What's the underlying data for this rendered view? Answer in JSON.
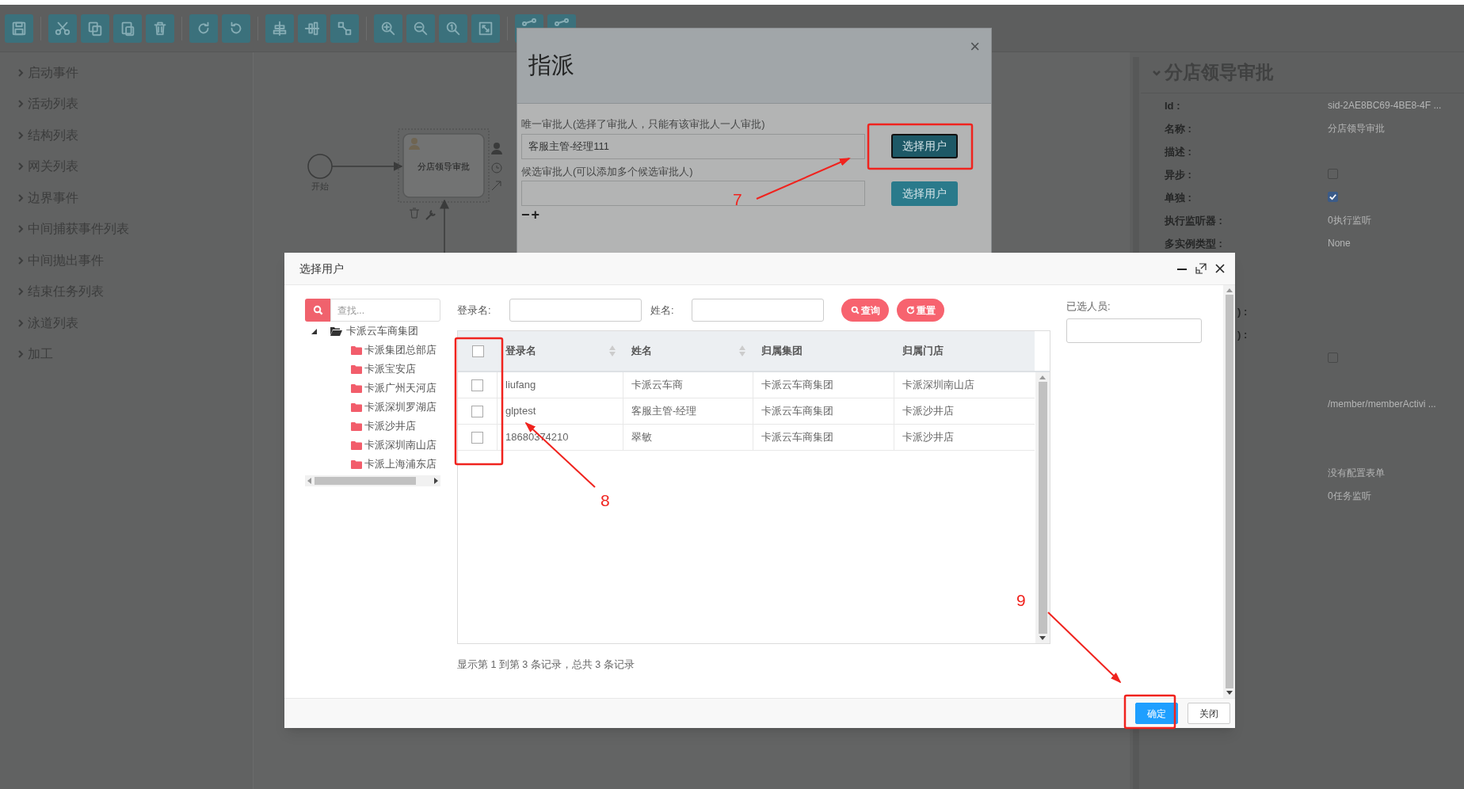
{
  "toolbar": {
    "groups": [
      {
        "buttons": [
          {
            "kind": "save"
          }
        ]
      },
      {
        "buttons": [
          {
            "kind": "cut"
          },
          {
            "kind": "copy"
          },
          {
            "kind": "paste"
          },
          {
            "kind": "delete"
          }
        ]
      },
      {
        "buttons": [
          {
            "kind": "redo"
          },
          {
            "kind": "undo"
          }
        ]
      },
      {
        "buttons": [
          {
            "kind": "align-horizontal"
          },
          {
            "kind": "align-vertical"
          },
          {
            "kind": "same-size"
          }
        ]
      },
      {
        "buttons": [
          {
            "kind": "zoom-in"
          },
          {
            "kind": "zoom-out"
          },
          {
            "kind": "zoom-actual"
          },
          {
            "kind": "zoom-fit"
          }
        ]
      },
      {
        "buttons": [
          {
            "kind": "connector"
          },
          {
            "kind": "connector"
          }
        ]
      }
    ]
  },
  "sidebar": {
    "items": [
      "启动事件",
      "活动列表",
      "结构列表",
      "网关列表",
      "边界事件",
      "中间捕获事件列表",
      "中间抛出事件",
      "结束任务列表",
      "泳道列表",
      "加工"
    ]
  },
  "canvas": {
    "start_event": {
      "label": "开始"
    },
    "task": {
      "label": "分店领导审批",
      "selected": true
    }
  },
  "properties": {
    "title": "分店领导审批",
    "expanded": true,
    "rows": [
      {
        "kind": "text",
        "label": "Id :",
        "value": "sid-2AE8BC69-4BE8-4F ..."
      },
      {
        "kind": "text",
        "label": "名称 :",
        "value": "分店领导审批"
      },
      {
        "kind": "text",
        "label": "描述 :"
      },
      {
        "kind": "checkbox",
        "label": "异步 :",
        "checked": false
      },
      {
        "kind": "checkbox",
        "label": "单独 :",
        "checked": true
      },
      {
        "kind": "text",
        "label": "执行监听器 :",
        "value": "0执行监听"
      },
      {
        "kind": "text",
        "label": "多实例类型 :",
        "value": "None"
      },
      {
        "kind": "covered"
      },
      {
        "kind": "covered"
      },
      {
        "kind": "cut",
        "label": ") :"
      },
      {
        "kind": "cut",
        "label": ") :"
      },
      {
        "kind": "checkbox",
        "checked": false
      },
      {
        "kind": "covered"
      },
      {
        "kind": "text",
        "value": "/member/memberActivi ..."
      },
      {
        "kind": "covered"
      },
      {
        "kind": "covered"
      },
      {
        "kind": "text",
        "value": "没有配置表单"
      },
      {
        "kind": "text",
        "value": "0任务监听"
      }
    ]
  },
  "assign_dialog": {
    "title": "指派",
    "close": "×",
    "fields": [
      {
        "label": "唯一审批人(选择了审批人，只能有该审批人一人审批)",
        "value": "客服主管-经理111",
        "button": "选择用户",
        "focused": true
      },
      {
        "label": "候选审批人(可以添加多个候选审批人)",
        "button": "选择用户",
        "focused": false
      }
    ],
    "row_controls": [
      "−",
      "+"
    ]
  },
  "select_dialog": {
    "title": "选择用户",
    "tree": {
      "search_placeholder": "查找...",
      "root": {
        "label": "卡派云车商集团",
        "expanded": true,
        "children": [
          {
            "label": "卡派集团总部店"
          },
          {
            "label": "卡派宝安店"
          },
          {
            "label": "卡派广州天河店"
          },
          {
            "label": "卡派深圳罗湖店"
          },
          {
            "label": "卡派沙井店"
          },
          {
            "label": "卡派深圳南山店"
          },
          {
            "label": "卡派上海浦东店"
          }
        ]
      }
    },
    "filters": [
      {
        "label": "登录名:"
      },
      {
        "label": "姓名:"
      }
    ],
    "buttons": [
      {
        "kind": "search",
        "label": "查询"
      },
      {
        "kind": "reset",
        "label": "重置"
      }
    ],
    "table": {
      "header_checked": false,
      "columns": [
        {
          "label": "登录名",
          "sortable": true
        },
        {
          "label": "姓名",
          "sortable": true
        },
        {
          "label": "归属集团",
          "sortable": false
        },
        {
          "label": "归属门店",
          "sortable": false
        }
      ],
      "rows": [
        {
          "checked": false,
          "cells": [
            "liufang",
            "卡派云车商",
            "卡派云车商集团",
            "卡派深圳南山店"
          ]
        },
        {
          "checked": false,
          "cells": [
            "glptest",
            "客服主管-经理",
            "卡派云车商集团",
            "卡派沙井店"
          ]
        },
        {
          "checked": false,
          "cells": [
            "18680374210",
            "翠敏",
            "卡派云车商集团",
            "卡派沙井店"
          ]
        }
      ]
    },
    "summary": "显示第 1 到第 3 条记录，总共 3 条记录",
    "selected_label": "已选人员:",
    "footer": [
      {
        "kind": "primary",
        "label": "确定"
      },
      {
        "kind": "default",
        "label": "关闭"
      }
    ]
  },
  "annotations": [
    {
      "number": "7"
    },
    {
      "number": "8"
    },
    {
      "number": "9"
    }
  ]
}
